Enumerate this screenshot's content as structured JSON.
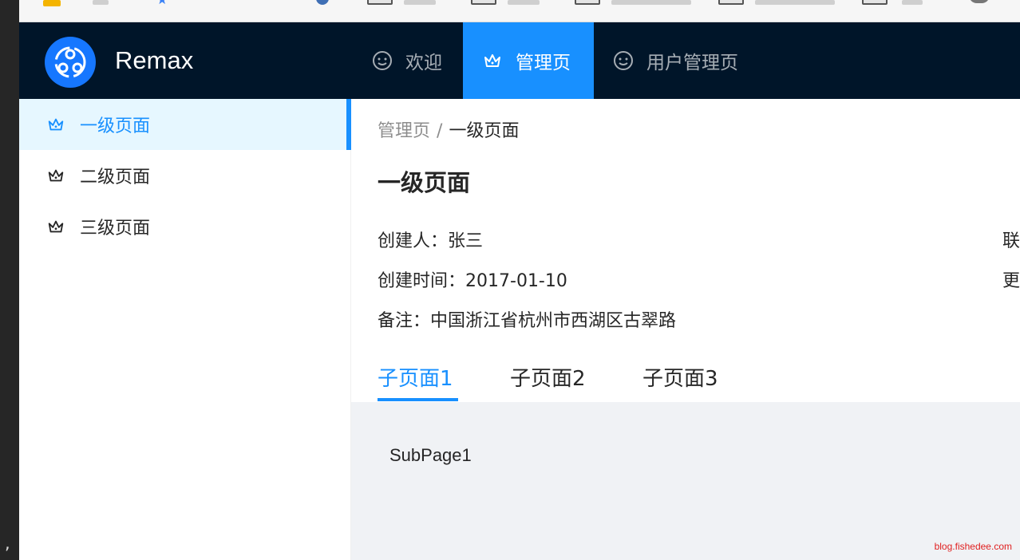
{
  "app": {
    "brand": "Remax"
  },
  "topnav": [
    {
      "label": "欢迎",
      "icon": "smile-icon",
      "active": false
    },
    {
      "label": "管理页",
      "icon": "crown-icon",
      "active": true
    },
    {
      "label": "用户管理页",
      "icon": "smile-icon",
      "active": false
    }
  ],
  "sidebar": {
    "items": [
      {
        "label": "一级页面",
        "icon": "crown-icon",
        "active": true
      },
      {
        "label": "二级页面",
        "icon": "crown-icon",
        "active": false
      },
      {
        "label": "三级页面",
        "icon": "crown-icon",
        "active": false
      }
    ]
  },
  "breadcrumb": {
    "parent": "管理页",
    "separator": "/",
    "current": "一级页面"
  },
  "page": {
    "title": "一级页面"
  },
  "description": {
    "creator_label": "创建人：",
    "creator_value": "张三",
    "created_label": "创建时间：",
    "created_value": "2017-01-10",
    "remark_label": "备注：",
    "remark_value": "中国浙江省杭州市西湖区古翠路",
    "right_label_1": "联",
    "right_label_2": "更"
  },
  "tabs": [
    {
      "label": "子页面1",
      "active": true
    },
    {
      "label": "子页面2",
      "active": false
    },
    {
      "label": "子页面3",
      "active": false
    }
  ],
  "subpage": {
    "text": "SubPage1"
  },
  "watermark": "blog.fishedee.com",
  "colors": {
    "header_bg": "#001529",
    "primary": "#1890ff",
    "menu_active_bg": "#e6f7ff",
    "content_bg": "#f0f2f5"
  }
}
